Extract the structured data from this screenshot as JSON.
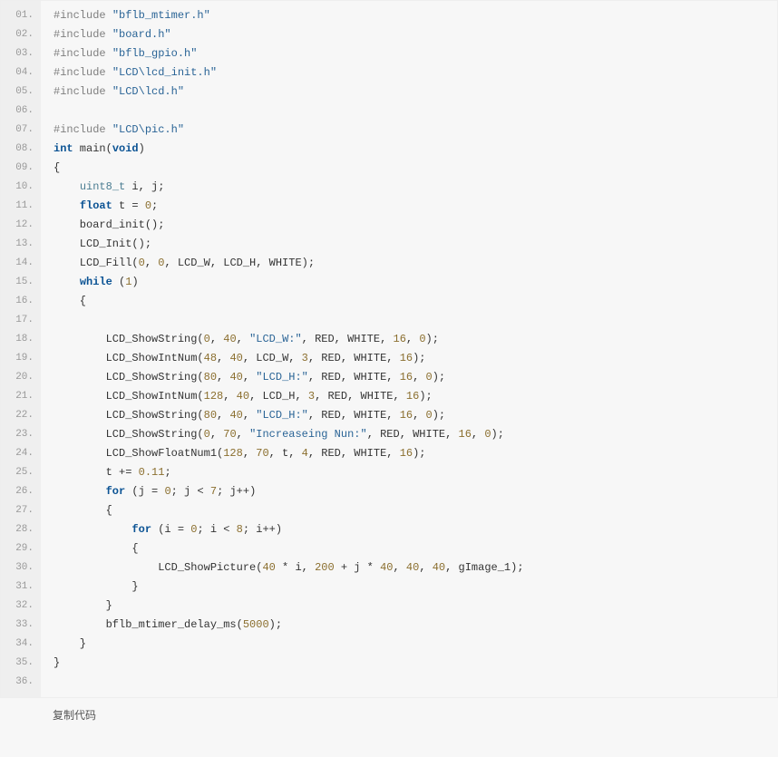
{
  "footer_label": "复制代码",
  "lines": [
    {
      "n": "01.",
      "tokens": [
        [
          "pp",
          "#include "
        ],
        [
          "str",
          "\"bflb_mtimer.h\""
        ]
      ]
    },
    {
      "n": "02.",
      "tokens": [
        [
          "pp",
          "#include "
        ],
        [
          "str",
          "\"board.h\""
        ]
      ]
    },
    {
      "n": "03.",
      "tokens": [
        [
          "pp",
          "#include "
        ],
        [
          "str",
          "\"bflb_gpio.h\""
        ]
      ]
    },
    {
      "n": "04.",
      "tokens": [
        [
          "pp",
          "#include "
        ],
        [
          "str",
          "\"LCD\\lcd_init.h\""
        ]
      ]
    },
    {
      "n": "05.",
      "tokens": [
        [
          "pp",
          "#include "
        ],
        [
          "str",
          "\"LCD\\lcd.h\""
        ]
      ]
    },
    {
      "n": "06.",
      "tokens": [
        [
          "pln",
          " "
        ]
      ]
    },
    {
      "n": "07.",
      "tokens": [
        [
          "pp",
          "#include "
        ],
        [
          "str",
          "\"LCD\\pic.h\""
        ]
      ]
    },
    {
      "n": "08.",
      "tokens": [
        [
          "kw",
          "int"
        ],
        [
          "pln",
          " main("
        ],
        [
          "kw",
          "void"
        ],
        [
          "pln",
          ")"
        ]
      ]
    },
    {
      "n": "09.",
      "tokens": [
        [
          "pln",
          "{"
        ]
      ]
    },
    {
      "n": "10.",
      "tokens": [
        [
          "pln",
          "    "
        ],
        [
          "ty",
          "uint8_t"
        ],
        [
          "pln",
          " i, j;"
        ]
      ]
    },
    {
      "n": "11.",
      "tokens": [
        [
          "pln",
          "    "
        ],
        [
          "kw",
          "float"
        ],
        [
          "pln",
          " t = "
        ],
        [
          "num",
          "0"
        ],
        [
          "pln",
          ";"
        ]
      ]
    },
    {
      "n": "12.",
      "tokens": [
        [
          "pln",
          "    board_init();"
        ]
      ]
    },
    {
      "n": "13.",
      "tokens": [
        [
          "pln",
          "    LCD_Init();"
        ]
      ]
    },
    {
      "n": "14.",
      "tokens": [
        [
          "pln",
          "    LCD_Fill("
        ],
        [
          "num",
          "0"
        ],
        [
          "pln",
          ", "
        ],
        [
          "num",
          "0"
        ],
        [
          "pln",
          ", LCD_W, LCD_H, WHITE);"
        ]
      ]
    },
    {
      "n": "15.",
      "tokens": [
        [
          "pln",
          "    "
        ],
        [
          "kw",
          "while"
        ],
        [
          "pln",
          " ("
        ],
        [
          "num",
          "1"
        ],
        [
          "pln",
          ")"
        ]
      ]
    },
    {
      "n": "16.",
      "tokens": [
        [
          "pln",
          "    {"
        ]
      ]
    },
    {
      "n": "17.",
      "tokens": [
        [
          "pln",
          " "
        ]
      ]
    },
    {
      "n": "18.",
      "tokens": [
        [
          "pln",
          "        LCD_ShowString("
        ],
        [
          "num",
          "0"
        ],
        [
          "pln",
          ", "
        ],
        [
          "num",
          "40"
        ],
        [
          "pln",
          ", "
        ],
        [
          "str",
          "\"LCD_W:\""
        ],
        [
          "pln",
          ", RED, WHITE, "
        ],
        [
          "num",
          "16"
        ],
        [
          "pln",
          ", "
        ],
        [
          "num",
          "0"
        ],
        [
          "pln",
          ");"
        ]
      ]
    },
    {
      "n": "19.",
      "tokens": [
        [
          "pln",
          "        LCD_ShowIntNum("
        ],
        [
          "num",
          "48"
        ],
        [
          "pln",
          ", "
        ],
        [
          "num",
          "40"
        ],
        [
          "pln",
          ", LCD_W, "
        ],
        [
          "num",
          "3"
        ],
        [
          "pln",
          ", RED, WHITE, "
        ],
        [
          "num",
          "16"
        ],
        [
          "pln",
          ");"
        ]
      ]
    },
    {
      "n": "20.",
      "tokens": [
        [
          "pln",
          "        LCD_ShowString("
        ],
        [
          "num",
          "80"
        ],
        [
          "pln",
          ", "
        ],
        [
          "num",
          "40"
        ],
        [
          "pln",
          ", "
        ],
        [
          "str",
          "\"LCD_H:\""
        ],
        [
          "pln",
          ", RED, WHITE, "
        ],
        [
          "num",
          "16"
        ],
        [
          "pln",
          ", "
        ],
        [
          "num",
          "0"
        ],
        [
          "pln",
          ");"
        ]
      ]
    },
    {
      "n": "21.",
      "tokens": [
        [
          "pln",
          "        LCD_ShowIntNum("
        ],
        [
          "num",
          "128"
        ],
        [
          "pln",
          ", "
        ],
        [
          "num",
          "40"
        ],
        [
          "pln",
          ", LCD_H, "
        ],
        [
          "num",
          "3"
        ],
        [
          "pln",
          ", RED, WHITE, "
        ],
        [
          "num",
          "16"
        ],
        [
          "pln",
          ");"
        ]
      ]
    },
    {
      "n": "22.",
      "tokens": [
        [
          "pln",
          "        LCD_ShowString("
        ],
        [
          "num",
          "80"
        ],
        [
          "pln",
          ", "
        ],
        [
          "num",
          "40"
        ],
        [
          "pln",
          ", "
        ],
        [
          "str",
          "\"LCD_H:\""
        ],
        [
          "pln",
          ", RED, WHITE, "
        ],
        [
          "num",
          "16"
        ],
        [
          "pln",
          ", "
        ],
        [
          "num",
          "0"
        ],
        [
          "pln",
          ");"
        ]
      ]
    },
    {
      "n": "23.",
      "tokens": [
        [
          "pln",
          "        LCD_ShowString("
        ],
        [
          "num",
          "0"
        ],
        [
          "pln",
          ", "
        ],
        [
          "num",
          "70"
        ],
        [
          "pln",
          ", "
        ],
        [
          "str",
          "\"Increaseing Nun:\""
        ],
        [
          "pln",
          ", RED, WHITE, "
        ],
        [
          "num",
          "16"
        ],
        [
          "pln",
          ", "
        ],
        [
          "num",
          "0"
        ],
        [
          "pln",
          ");"
        ]
      ]
    },
    {
      "n": "24.",
      "tokens": [
        [
          "pln",
          "        LCD_ShowFloatNum1("
        ],
        [
          "num",
          "128"
        ],
        [
          "pln",
          ", "
        ],
        [
          "num",
          "70"
        ],
        [
          "pln",
          ", t, "
        ],
        [
          "num",
          "4"
        ],
        [
          "pln",
          ", RED, WHITE, "
        ],
        [
          "num",
          "16"
        ],
        [
          "pln",
          ");"
        ]
      ]
    },
    {
      "n": "25.",
      "tokens": [
        [
          "pln",
          "        t += "
        ],
        [
          "num",
          "0.11"
        ],
        [
          "pln",
          ";"
        ]
      ]
    },
    {
      "n": "26.",
      "tokens": [
        [
          "pln",
          "        "
        ],
        [
          "kw",
          "for"
        ],
        [
          "pln",
          " (j = "
        ],
        [
          "num",
          "0"
        ],
        [
          "pln",
          "; j < "
        ],
        [
          "num",
          "7"
        ],
        [
          "pln",
          "; j++)"
        ]
      ]
    },
    {
      "n": "27.",
      "tokens": [
        [
          "pln",
          "        {"
        ]
      ]
    },
    {
      "n": "28.",
      "tokens": [
        [
          "pln",
          "            "
        ],
        [
          "kw",
          "for"
        ],
        [
          "pln",
          " (i = "
        ],
        [
          "num",
          "0"
        ],
        [
          "pln",
          "; i < "
        ],
        [
          "num",
          "8"
        ],
        [
          "pln",
          "; i++)"
        ]
      ]
    },
    {
      "n": "29.",
      "tokens": [
        [
          "pln",
          "            {"
        ]
      ]
    },
    {
      "n": "30.",
      "tokens": [
        [
          "pln",
          "                LCD_ShowPicture("
        ],
        [
          "num",
          "40"
        ],
        [
          "pln",
          " * i, "
        ],
        [
          "num",
          "200"
        ],
        [
          "pln",
          " + j * "
        ],
        [
          "num",
          "40"
        ],
        [
          "pln",
          ", "
        ],
        [
          "num",
          "40"
        ],
        [
          "pln",
          ", "
        ],
        [
          "num",
          "40"
        ],
        [
          "pln",
          ", gImage_1);"
        ]
      ]
    },
    {
      "n": "31.",
      "tokens": [
        [
          "pln",
          "            }"
        ]
      ]
    },
    {
      "n": "32.",
      "tokens": [
        [
          "pln",
          "        }"
        ]
      ]
    },
    {
      "n": "33.",
      "tokens": [
        [
          "pln",
          "        bflb_mtimer_delay_ms("
        ],
        [
          "num",
          "5000"
        ],
        [
          "pln",
          ");"
        ]
      ]
    },
    {
      "n": "34.",
      "tokens": [
        [
          "pln",
          "    }"
        ]
      ]
    },
    {
      "n": "35.",
      "tokens": [
        [
          "pln",
          "}"
        ]
      ]
    },
    {
      "n": "36.",
      "tokens": [
        [
          "pln",
          " "
        ]
      ]
    }
  ]
}
